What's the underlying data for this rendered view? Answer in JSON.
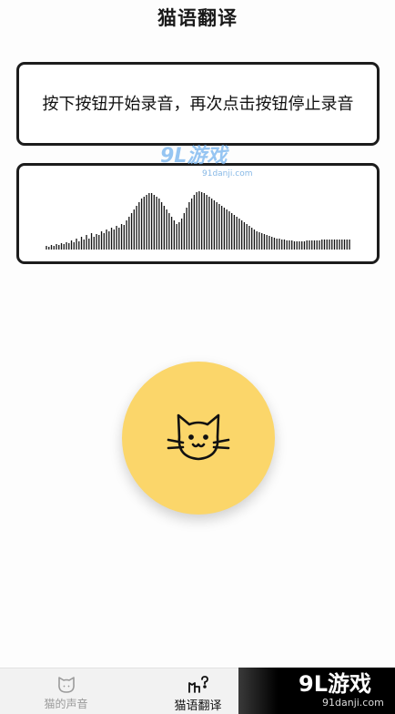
{
  "header": {
    "title": "猫语翻译"
  },
  "instruction": {
    "text": "按下按钮开始录音，再次点击按钮停止录音"
  },
  "waveform": {
    "levels": [
      4,
      3,
      5,
      4,
      6,
      5,
      7,
      6,
      8,
      7,
      10,
      8,
      12,
      9,
      14,
      11,
      16,
      12,
      18,
      14,
      17,
      16,
      20,
      18,
      22,
      20,
      24,
      22,
      26,
      24,
      28,
      27,
      32,
      36,
      40,
      44,
      48,
      52,
      56,
      58,
      60,
      62,
      62,
      60,
      58,
      56,
      52,
      48,
      44,
      40,
      36,
      32,
      28,
      30,
      34,
      40,
      46,
      52,
      56,
      60,
      63,
      64,
      63,
      62,
      60,
      58,
      56,
      54,
      52,
      50,
      48,
      46,
      44,
      42,
      40,
      38,
      36,
      34,
      32,
      30,
      28,
      26,
      24,
      22,
      20,
      19,
      18,
      17,
      16,
      15,
      14,
      13,
      12,
      12,
      11,
      11,
      10,
      10,
      10,
      9,
      9,
      9,
      9,
      9,
      10,
      10,
      10,
      10,
      10,
      10,
      11,
      11,
      11,
      11,
      11,
      11,
      11,
      11,
      11,
      11,
      11,
      11
    ]
  },
  "record_button": {
    "icon": "cat-face-icon",
    "color": "#fbd66a"
  },
  "bottom_nav": {
    "items": [
      {
        "label": "猫的声音",
        "icon": "cat-head-icon",
        "active": false
      },
      {
        "label": "猫语翻译",
        "icon": "cat-speak-icon",
        "active": true
      }
    ]
  },
  "watermark": {
    "brand": "9L游戏",
    "domain": "91danji.com"
  }
}
